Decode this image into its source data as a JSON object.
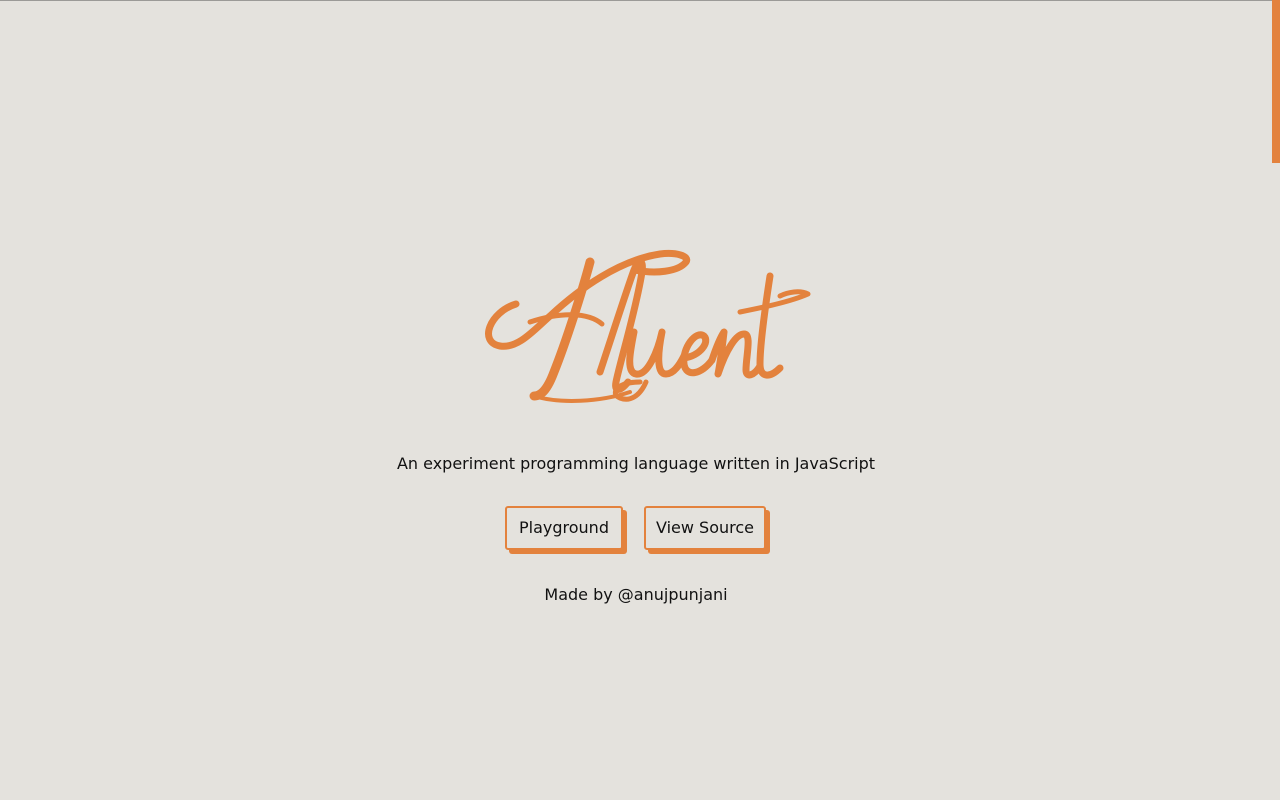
{
  "brand": {
    "logo_text": "Fluent",
    "accent_color": "#e3823d",
    "background_color": "#e4e2dd"
  },
  "hero": {
    "tagline": "An experiment programming language written in JavaScript"
  },
  "actions": {
    "playground_label": "Playground",
    "source_label": "View Source"
  },
  "footer": {
    "credit": "Made by @anujpunjani"
  }
}
